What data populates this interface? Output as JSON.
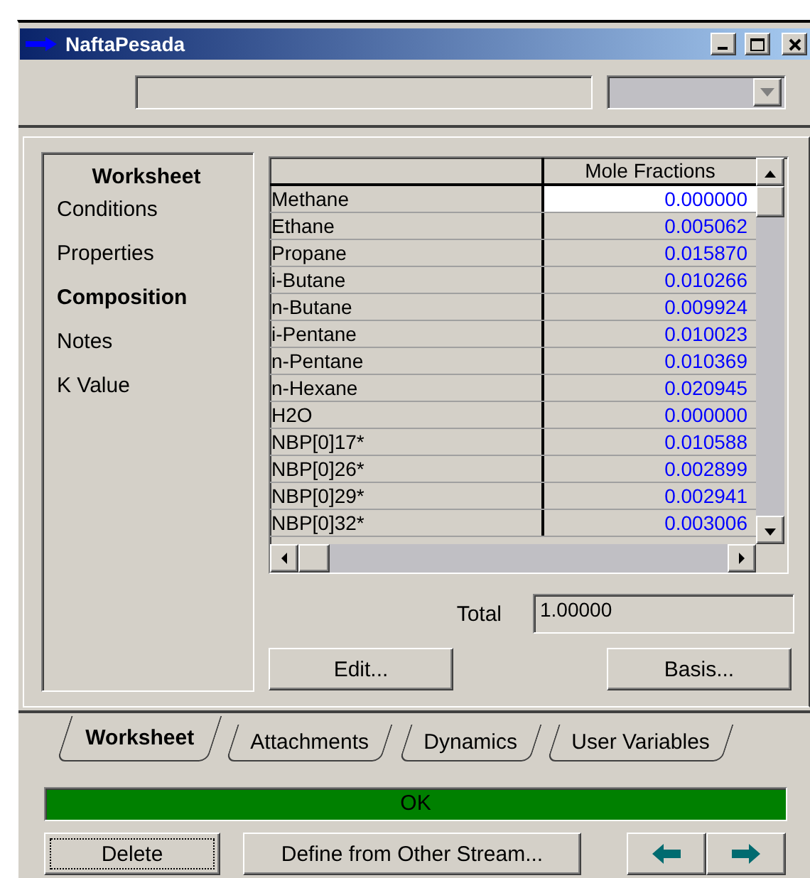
{
  "window": {
    "title": "NaftaPesada"
  },
  "sidebar": {
    "title": "Worksheet",
    "items": [
      {
        "label": "Conditions",
        "selected": false
      },
      {
        "label": "Properties",
        "selected": false
      },
      {
        "label": "Composition",
        "selected": true
      },
      {
        "label": "Notes",
        "selected": false
      },
      {
        "label": "K Value",
        "selected": false
      }
    ]
  },
  "table": {
    "columns": [
      "Mole Fractions"
    ],
    "rows": [
      {
        "name": "Methane",
        "value": "0.000000",
        "selected": true
      },
      {
        "name": "Ethane",
        "value": "0.005062",
        "selected": false
      },
      {
        "name": "Propane",
        "value": "0.015870",
        "selected": false
      },
      {
        "name": "i-Butane",
        "value": "0.010266",
        "selected": false
      },
      {
        "name": "n-Butane",
        "value": "0.009924",
        "selected": false
      },
      {
        "name": "i-Pentane",
        "value": "0.010023",
        "selected": false
      },
      {
        "name": "n-Pentane",
        "value": "0.010369",
        "selected": false
      },
      {
        "name": "n-Hexane",
        "value": "0.020945",
        "selected": false
      },
      {
        "name": "H2O",
        "value": "0.000000",
        "selected": false
      },
      {
        "name": "NBP[0]17*",
        "value": "0.010588",
        "selected": false
      },
      {
        "name": "NBP[0]26*",
        "value": "0.002899",
        "selected": false
      },
      {
        "name": "NBP[0]29*",
        "value": "0.002941",
        "selected": false
      },
      {
        "name": "NBP[0]32*",
        "value": "0.003006",
        "selected": false
      }
    ]
  },
  "total": {
    "label": "Total",
    "value": "1.00000"
  },
  "panel_buttons": [
    "Edit...",
    "Basis..."
  ],
  "tabs": [
    {
      "label": "Worksheet",
      "selected": true
    },
    {
      "label": "Attachments",
      "selected": false
    },
    {
      "label": "Dynamics",
      "selected": false
    },
    {
      "label": "User Variables",
      "selected": false
    }
  ],
  "status": {
    "text": "OK",
    "kind": "ok"
  },
  "footer_buttons": [
    {
      "label": "Delete",
      "focused": true
    },
    {
      "label": "Define from Other Stream...",
      "focused": false
    }
  ]
}
